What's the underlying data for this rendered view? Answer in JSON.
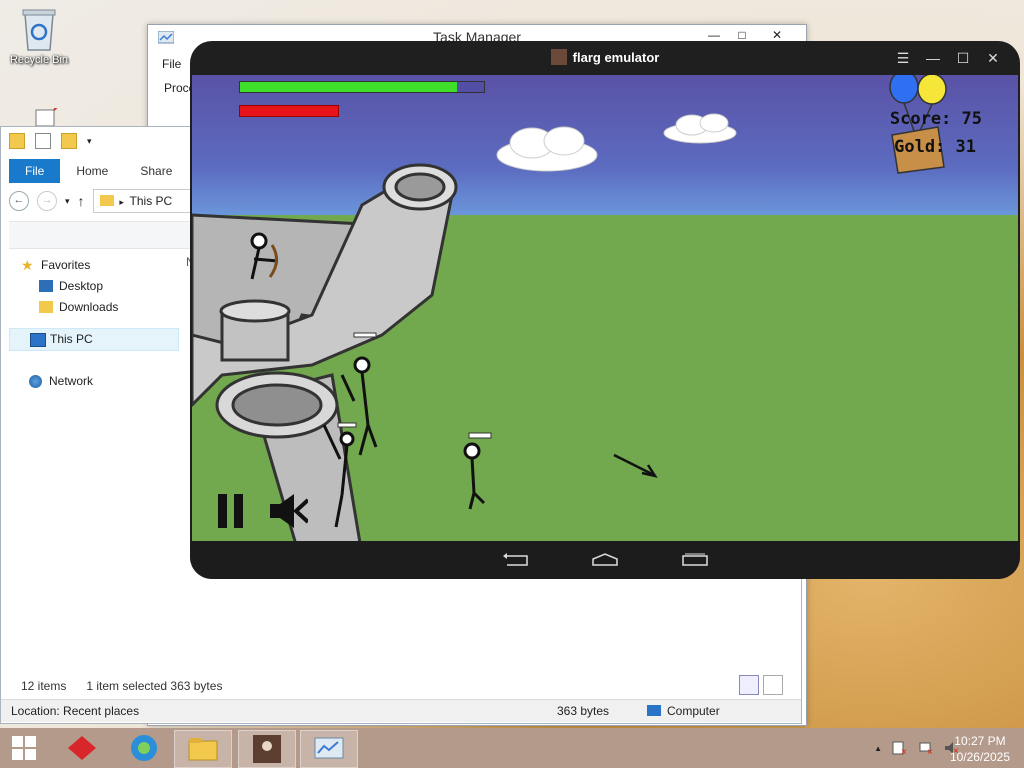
{
  "desktop": {
    "recycle_bin_label": "Recycle Bin"
  },
  "task_manager": {
    "title": "Task Manager",
    "menu_file": "File",
    "tab_processes": "Proce",
    "btn_minimize": "—",
    "btn_maximize": "□",
    "btn_close": "✕"
  },
  "explorer": {
    "ribbon": {
      "file": "File",
      "home": "Home",
      "share": "Share"
    },
    "address": "This PC",
    "nav": {
      "favorites": "Favorites",
      "desktop": "Desktop",
      "downloads": "Downloads",
      "this_pc": "This PC",
      "network": "Network"
    },
    "column_hint": "N",
    "status": {
      "items": "12 items",
      "selected": "1 item selected  363 bytes"
    },
    "details_bar": {
      "location": "Location: Recent places",
      "size": "363 bytes",
      "computer": "Computer"
    }
  },
  "emulator": {
    "title": "flarg emulator",
    "window_buttons": [
      "☰",
      "—",
      "☐",
      "✕"
    ],
    "game": {
      "player_health_fraction": 0.89,
      "enemy_health_fraction": 0.4,
      "score_label": "Score: 75",
      "gold_label": "Gold: 31",
      "pause_icon": "pause-icon",
      "sound_icon": "speaker-icon"
    }
  },
  "taskbar": {
    "time": "10:27 PM",
    "date": "10/26/2025",
    "tray_arrow": "▲"
  },
  "colors": {
    "accent": "#1979ca",
    "health_green": "#3ede2a",
    "health_red": "#e8141c",
    "grass": "#72a84e",
    "sky": "#5c6cc0"
  }
}
